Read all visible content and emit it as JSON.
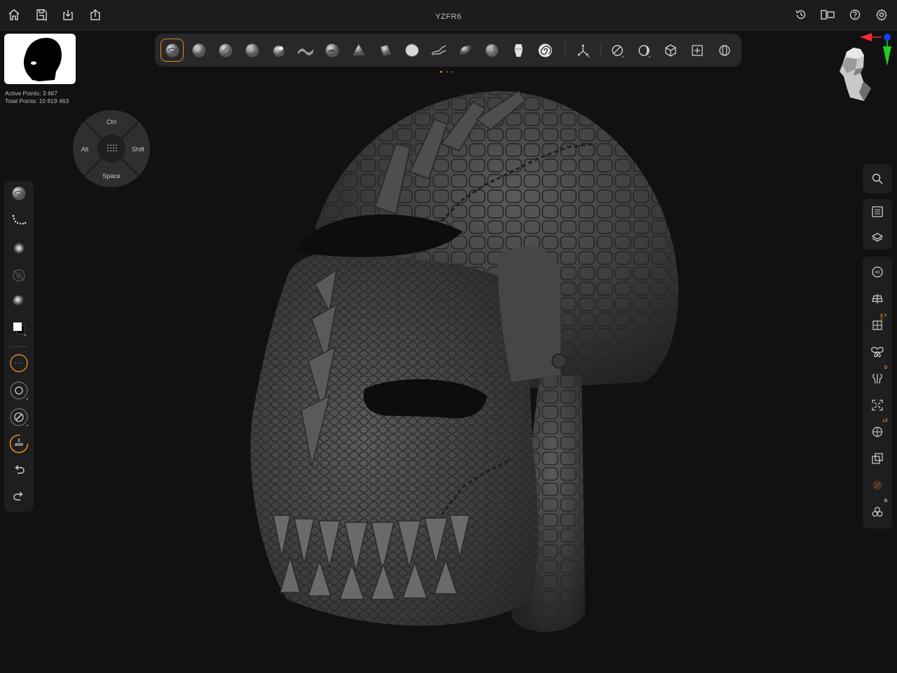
{
  "title": "YZFR6",
  "stats": {
    "active_points": "Active Points: 3 667",
    "total_points": "Total Points: 10 819 463"
  },
  "modifier_pad": {
    "top": "Ctrl",
    "left": "Alt",
    "right": "Shift",
    "bottom": "Space"
  },
  "left_tool_badge": {
    "line1": "Z",
    "line2": "ADD"
  },
  "right_badges": {
    "xyz": "X Y Z",
    "d1": "D",
    "lf": "LF",
    "d2": "D"
  },
  "brushes": [
    "clay-buildup-brush",
    "standard-brush",
    "move-brush",
    "smooth-brush",
    "inflate-brush",
    "dam-standard-brush",
    "clay-brush",
    "pinch-brush",
    "trim-brush",
    "flatten-brush",
    "snakehook-brush",
    "polish-brush",
    "hpolish-brush",
    "mask-brush",
    "curve-brush"
  ],
  "accent_color": "#e08a1d",
  "brush_page_indicator": {
    "pages": 3,
    "current": 1
  }
}
